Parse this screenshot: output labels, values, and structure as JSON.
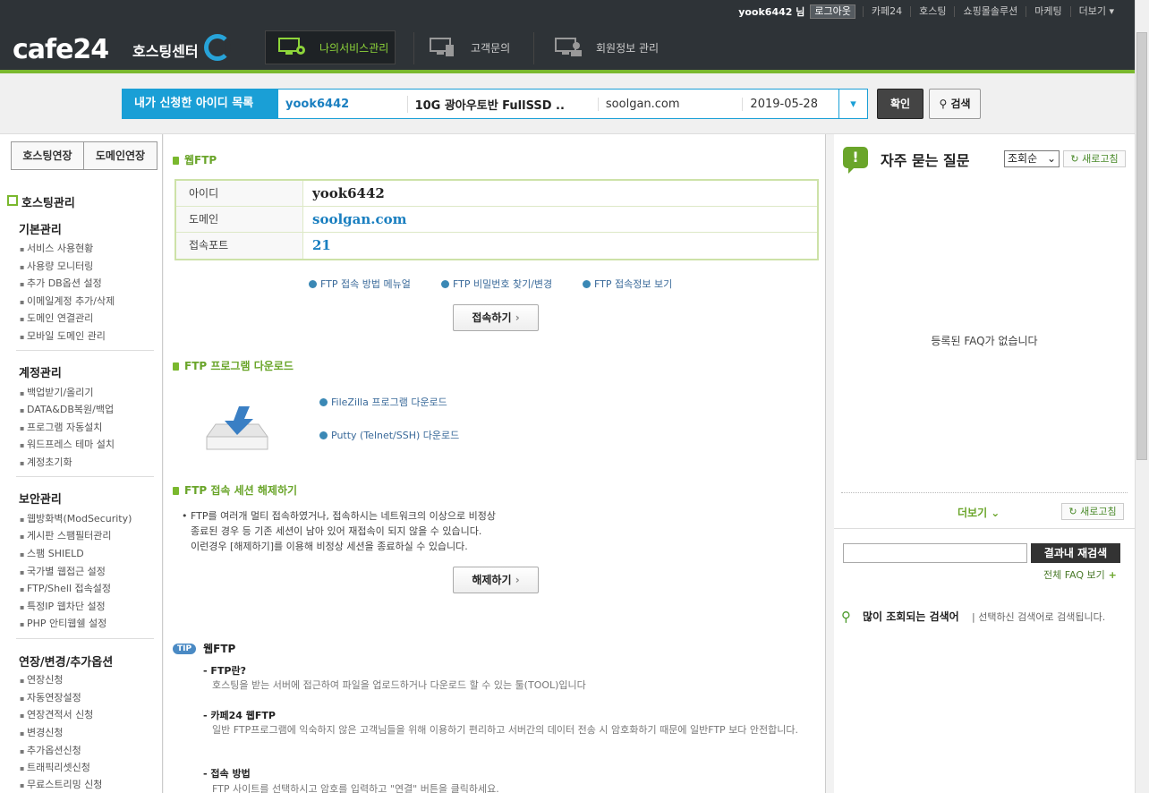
{
  "topbar": {
    "user": "yook6442 님",
    "logout": "로그아웃",
    "links": [
      "카페24",
      "호스팅",
      "쇼핑몰솔루션",
      "마케팅",
      "더보기"
    ],
    "logo": "cafe24",
    "logo_sub": "호스팅센터",
    "nav": [
      "나의서비스관리",
      "고객문의",
      "회원정보 관리"
    ]
  },
  "idrow": {
    "label": "내가 신청한 아이디 목록",
    "id": "yook6442",
    "product": "10G 광아우토반 FullSSD ..",
    "domain": "soolgan.com",
    "date": "2019-05-28",
    "confirm": "확인",
    "search": "검색"
  },
  "sidebar": {
    "btn_extend": "호스팅연장",
    "btn_domain": "도메인연장",
    "head": "호스팅관리",
    "cat1": "기본관리",
    "cat1_items": [
      "서비스 사용현황",
      "사용량 모니터링",
      "추가 DB옵션 설정",
      "이메일계정 추가/삭제",
      "도메인 연결관리",
      "모바일 도메인 관리"
    ],
    "cat2": "계정관리",
    "cat2_items": [
      "백업받기/올리기",
      "DATA&DB복원/백업",
      "프로그램 자동설치",
      "워드프레스 테마 설치",
      "계정초기화"
    ],
    "cat3": "보안관리",
    "cat3_items": [
      "웹방화벽(ModSecurity)",
      "게시판 스팸필터관리",
      "스팸 SHIELD",
      "국가별 웹접근 설정",
      "FTP/Shell 접속설정",
      "특정IP 웹차단 설정",
      "PHP 안티웹쉘 설정"
    ],
    "cat4": "연장/변경/추가옵션",
    "cat4_items": [
      "연장신청",
      "자동연장설정",
      "연장견적서 신청",
      "변경신청",
      "추가옵션신청",
      "트래픽리셋신청",
      "무료스트리밍 신청"
    ]
  },
  "center": {
    "webftp_title": "웹FTP",
    "table": [
      {
        "k": "아이디",
        "v": "yook6442"
      },
      {
        "k": "도메인",
        "v": "soolgan.com"
      },
      {
        "k": "접속포트",
        "v": "21"
      }
    ],
    "links": [
      "FTP 접속 방법 메뉴얼",
      "FTP 비밀번호 찾기/변경",
      "FTP 접속정보 보기"
    ],
    "connect_btn": "접속하기",
    "download_title": "FTP 프로그램 다운로드",
    "dl_links": [
      "FileZilla 프로그램 다운로드",
      "Putty (Telnet/SSH) 다운로드"
    ],
    "session_title": "FTP 접속 세션 해제하기",
    "session_text": [
      "FTP를 여러개 멀티 접속하였거나, 접속하시는 네트워크의 이상으로 비정상",
      "종료된 경우 등 기존 세션이 남아 있어 재접속이 되지 않을 수 있습니다.",
      "이런경우 [해제하기]를 이용해 비정상 세션을 종료하실 수 있습니다."
    ],
    "release_btn": "해제하기",
    "tip_badge": "TIP",
    "tip_title": "웹FTP",
    "tips": [
      {
        "t": "- FTP란?",
        "d": "호스팅을 받는 서버에 접근하여 파일을 업로드하거나 다운로드 할 수 있는 툴(TOOL)입니다"
      },
      {
        "t": "- 카페24 웹FTP",
        "d": "일반 FTP프로그램에 익숙하지 않은 고객님들을 위해 이용하기 편리하고 서버간의 데이터 전송 시 암호화하기 때문에 일반FTP 보다 안전합니다."
      },
      {
        "t": "- 접속 방법",
        "d": "FTP 사이트를 선택하시고 암호를 입력하고 \"연결\" 버튼을 클릭하세요."
      }
    ]
  },
  "right": {
    "faq_title": "자주 묻는 질문",
    "faq_sort": "조회순",
    "refresh": "새로고침",
    "faq_empty": "등록된 FAQ가 없습니다",
    "more": "더보기",
    "search_btn": "결과내 재검색",
    "all_faq": "전체 FAQ 보기",
    "popular_title": "많이 조회되는 검색어",
    "popular_desc": "| 선택하신 검색어로 검색됩니다."
  },
  "colors": {
    "accent_green": "#7ab82e",
    "accent_blue": "#1a9fd6",
    "topbar": "#2e3337"
  }
}
